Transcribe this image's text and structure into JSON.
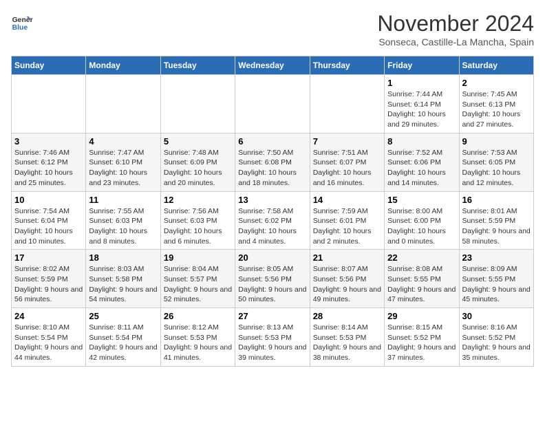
{
  "logo": {
    "line1": "General",
    "line2": "Blue"
  },
  "title": "November 2024",
  "subtitle": "Sonseca, Castille-La Mancha, Spain",
  "days_of_week": [
    "Sunday",
    "Monday",
    "Tuesday",
    "Wednesday",
    "Thursday",
    "Friday",
    "Saturday"
  ],
  "weeks": [
    [
      {
        "day": "",
        "info": ""
      },
      {
        "day": "",
        "info": ""
      },
      {
        "day": "",
        "info": ""
      },
      {
        "day": "",
        "info": ""
      },
      {
        "day": "",
        "info": ""
      },
      {
        "day": "1",
        "info": "Sunrise: 7:44 AM\nSunset: 6:14 PM\nDaylight: 10 hours and 29 minutes."
      },
      {
        "day": "2",
        "info": "Sunrise: 7:45 AM\nSunset: 6:13 PM\nDaylight: 10 hours and 27 minutes."
      }
    ],
    [
      {
        "day": "3",
        "info": "Sunrise: 7:46 AM\nSunset: 6:12 PM\nDaylight: 10 hours and 25 minutes."
      },
      {
        "day": "4",
        "info": "Sunrise: 7:47 AM\nSunset: 6:10 PM\nDaylight: 10 hours and 23 minutes."
      },
      {
        "day": "5",
        "info": "Sunrise: 7:48 AM\nSunset: 6:09 PM\nDaylight: 10 hours and 20 minutes."
      },
      {
        "day": "6",
        "info": "Sunrise: 7:50 AM\nSunset: 6:08 PM\nDaylight: 10 hours and 18 minutes."
      },
      {
        "day": "7",
        "info": "Sunrise: 7:51 AM\nSunset: 6:07 PM\nDaylight: 10 hours and 16 minutes."
      },
      {
        "day": "8",
        "info": "Sunrise: 7:52 AM\nSunset: 6:06 PM\nDaylight: 10 hours and 14 minutes."
      },
      {
        "day": "9",
        "info": "Sunrise: 7:53 AM\nSunset: 6:05 PM\nDaylight: 10 hours and 12 minutes."
      }
    ],
    [
      {
        "day": "10",
        "info": "Sunrise: 7:54 AM\nSunset: 6:04 PM\nDaylight: 10 hours and 10 minutes."
      },
      {
        "day": "11",
        "info": "Sunrise: 7:55 AM\nSunset: 6:03 PM\nDaylight: 10 hours and 8 minutes."
      },
      {
        "day": "12",
        "info": "Sunrise: 7:56 AM\nSunset: 6:03 PM\nDaylight: 10 hours and 6 minutes."
      },
      {
        "day": "13",
        "info": "Sunrise: 7:58 AM\nSunset: 6:02 PM\nDaylight: 10 hours and 4 minutes."
      },
      {
        "day": "14",
        "info": "Sunrise: 7:59 AM\nSunset: 6:01 PM\nDaylight: 10 hours and 2 minutes."
      },
      {
        "day": "15",
        "info": "Sunrise: 8:00 AM\nSunset: 6:00 PM\nDaylight: 10 hours and 0 minutes."
      },
      {
        "day": "16",
        "info": "Sunrise: 8:01 AM\nSunset: 5:59 PM\nDaylight: 9 hours and 58 minutes."
      }
    ],
    [
      {
        "day": "17",
        "info": "Sunrise: 8:02 AM\nSunset: 5:59 PM\nDaylight: 9 hours and 56 minutes."
      },
      {
        "day": "18",
        "info": "Sunrise: 8:03 AM\nSunset: 5:58 PM\nDaylight: 9 hours and 54 minutes."
      },
      {
        "day": "19",
        "info": "Sunrise: 8:04 AM\nSunset: 5:57 PM\nDaylight: 9 hours and 52 minutes."
      },
      {
        "day": "20",
        "info": "Sunrise: 8:05 AM\nSunset: 5:56 PM\nDaylight: 9 hours and 50 minutes."
      },
      {
        "day": "21",
        "info": "Sunrise: 8:07 AM\nSunset: 5:56 PM\nDaylight: 9 hours and 49 minutes."
      },
      {
        "day": "22",
        "info": "Sunrise: 8:08 AM\nSunset: 5:55 PM\nDaylight: 9 hours and 47 minutes."
      },
      {
        "day": "23",
        "info": "Sunrise: 8:09 AM\nSunset: 5:55 PM\nDaylight: 9 hours and 45 minutes."
      }
    ],
    [
      {
        "day": "24",
        "info": "Sunrise: 8:10 AM\nSunset: 5:54 PM\nDaylight: 9 hours and 44 minutes."
      },
      {
        "day": "25",
        "info": "Sunrise: 8:11 AM\nSunset: 5:54 PM\nDaylight: 9 hours and 42 minutes."
      },
      {
        "day": "26",
        "info": "Sunrise: 8:12 AM\nSunset: 5:53 PM\nDaylight: 9 hours and 41 minutes."
      },
      {
        "day": "27",
        "info": "Sunrise: 8:13 AM\nSunset: 5:53 PM\nDaylight: 9 hours and 39 minutes."
      },
      {
        "day": "28",
        "info": "Sunrise: 8:14 AM\nSunset: 5:53 PM\nDaylight: 9 hours and 38 minutes."
      },
      {
        "day": "29",
        "info": "Sunrise: 8:15 AM\nSunset: 5:52 PM\nDaylight: 9 hours and 37 minutes."
      },
      {
        "day": "30",
        "info": "Sunrise: 8:16 AM\nSunset: 5:52 PM\nDaylight: 9 hours and 35 minutes."
      }
    ]
  ]
}
